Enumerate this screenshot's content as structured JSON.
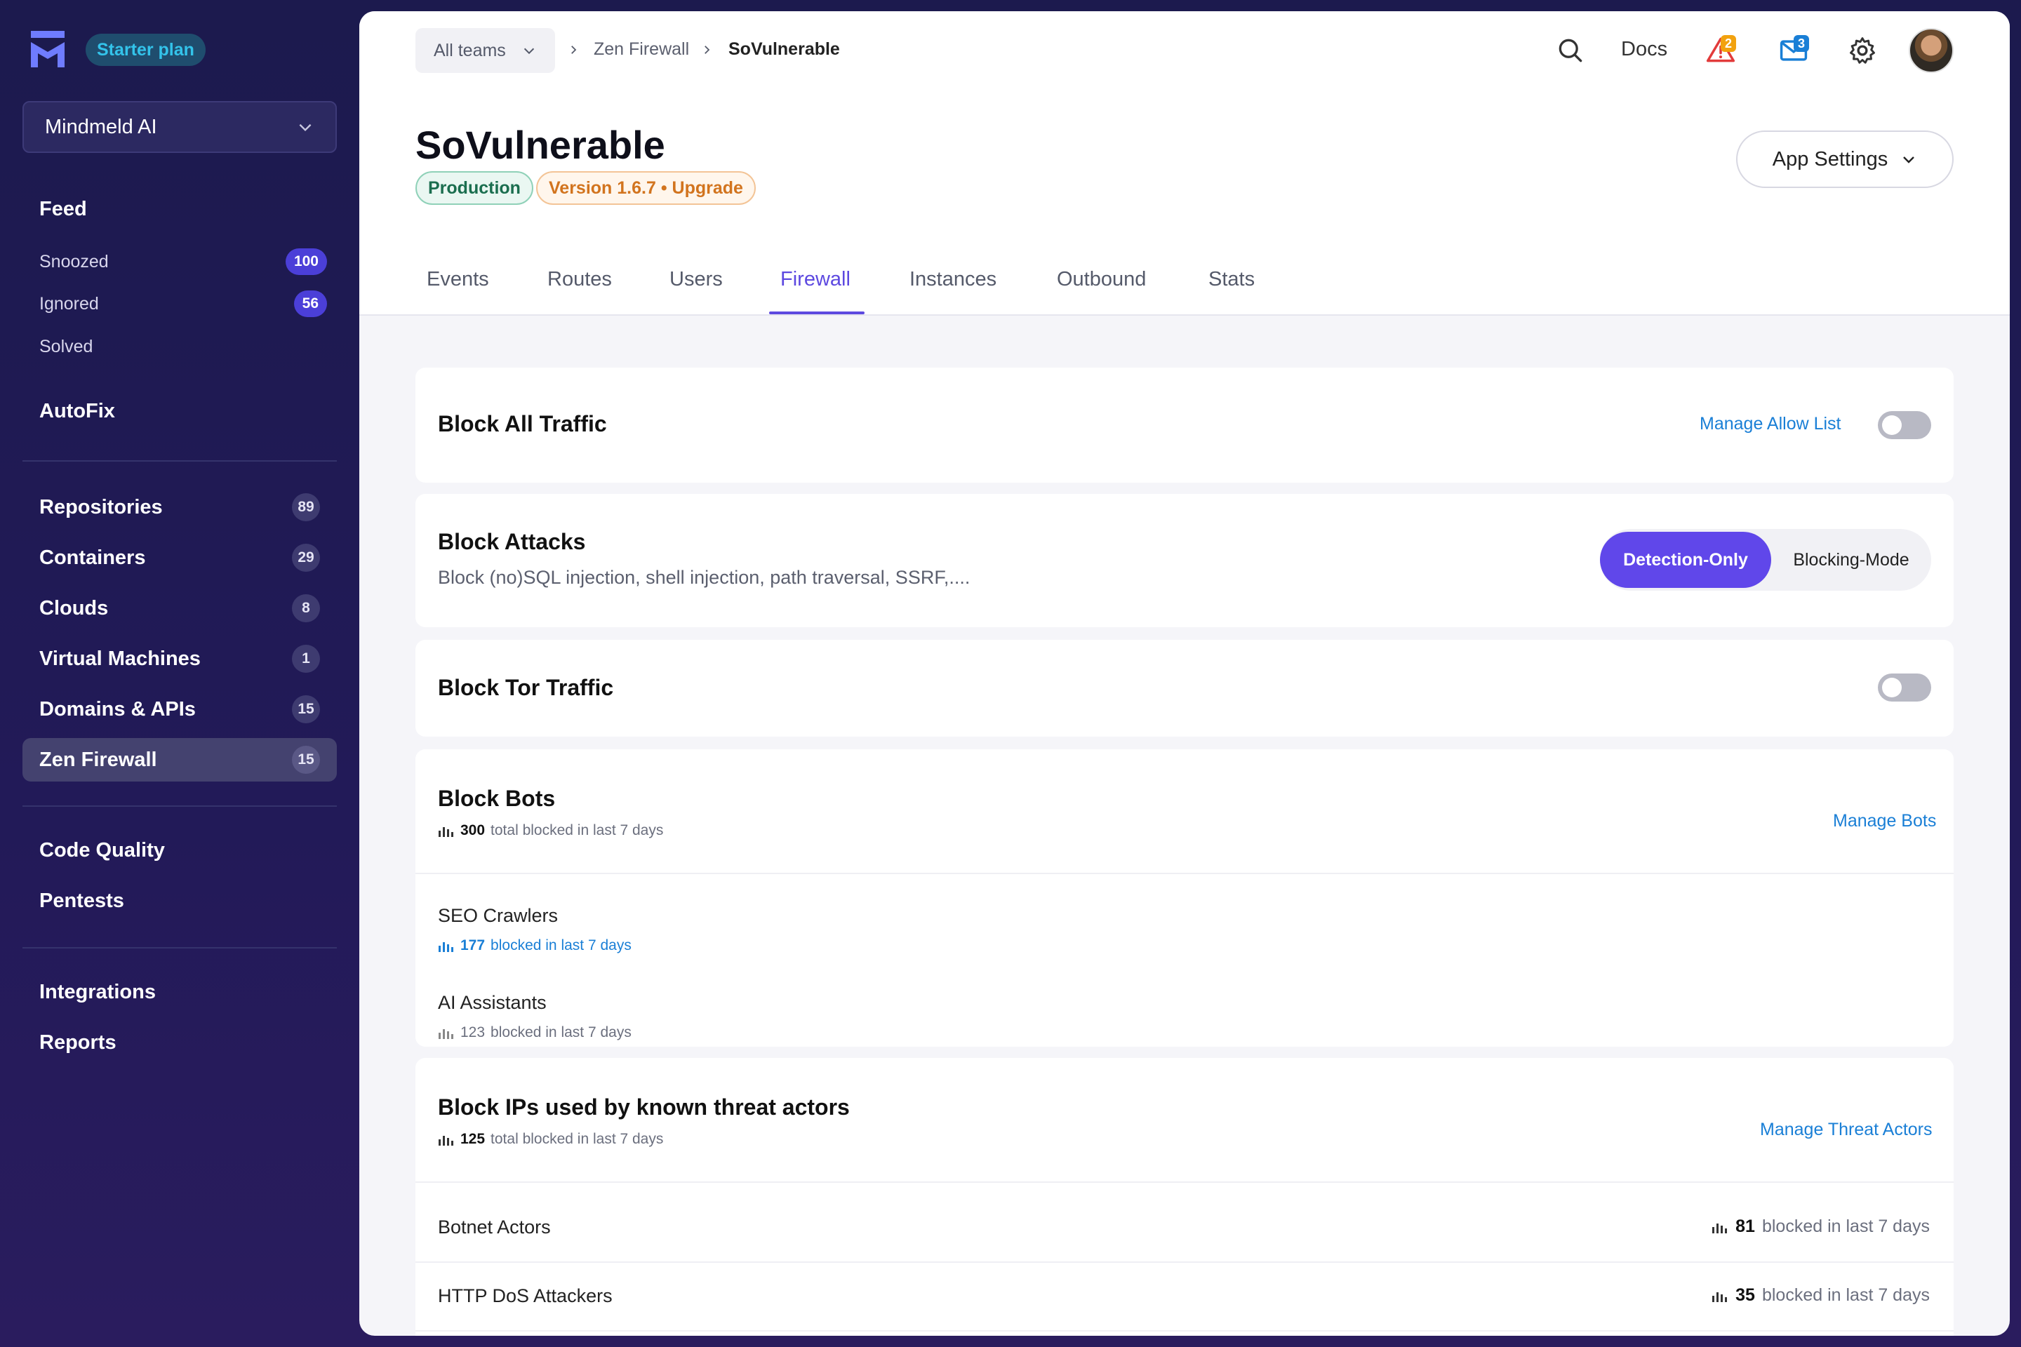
{
  "sidebar": {
    "plan": "Starter plan",
    "team": "Mindmeld AI",
    "feed": "Feed",
    "sub_items": [
      {
        "label": "Snoozed",
        "count": "100"
      },
      {
        "label": "Ignored",
        "count": "56"
      },
      {
        "label": "Solved",
        "count": ""
      }
    ],
    "autofix": "AutoFix",
    "resources": [
      {
        "label": "Repositories",
        "count": "89"
      },
      {
        "label": "Containers",
        "count": "29"
      },
      {
        "label": "Clouds",
        "count": "8"
      },
      {
        "label": "Virtual Machines",
        "count": "1"
      },
      {
        "label": "Domains & APIs",
        "count": "15"
      },
      {
        "label": "Zen Firewall",
        "count": "15"
      }
    ],
    "extras": [
      "Code Quality",
      "Pentests"
    ],
    "bottom": [
      "Integrations",
      "Reports"
    ]
  },
  "header": {
    "team_filter": "All teams",
    "breadcrumb": [
      "Zen Firewall",
      "SoVulnerable"
    ],
    "docs": "Docs",
    "alerts_count": "2",
    "inbox_count": "3",
    "title": "SoVulnerable",
    "env_badge": "Production",
    "version_badge": "Version 1.6.7 • Upgrade",
    "app_settings": "App Settings",
    "tabs": [
      "Events",
      "Routes",
      "Users",
      "Firewall",
      "Instances",
      "Outbound",
      "Stats"
    ],
    "active_tab": "Firewall"
  },
  "firewall": {
    "block_all": {
      "title": "Block All Traffic",
      "link": "Manage Allow List",
      "enabled": false
    },
    "block_attacks": {
      "title": "Block Attacks",
      "desc": "Block (no)SQL injection, shell injection, path traversal, SSRF,....",
      "mode_a": "Detection-Only",
      "mode_b": "Blocking-Mode",
      "active_mode": "Detection-Only"
    },
    "block_tor": {
      "title": "Block Tor Traffic",
      "enabled": false
    },
    "block_bots": {
      "title": "Block Bots",
      "total": "300",
      "total_suffix": "total blocked in last 7 days",
      "link": "Manage Bots",
      "rows": [
        {
          "name": "SEO Crawlers",
          "count": "177",
          "suffix": "blocked in last 7 days"
        },
        {
          "name": "AI Assistants",
          "count": "123",
          "suffix": "blocked in last 7 days"
        }
      ]
    },
    "block_threats": {
      "title": "Block IPs used by known threat actors",
      "total": "125",
      "total_suffix": "total blocked in last 7 days",
      "link": "Manage Threat Actors",
      "rows": [
        {
          "name": "Botnet Actors",
          "count": "81",
          "suffix": "blocked in last 7 days"
        },
        {
          "name": "HTTP DoS Attackers",
          "count": "35",
          "suffix": "blocked in last 7 days"
        }
      ]
    }
  },
  "colors": {
    "accent": "#6047ea",
    "link": "#1a7fd6",
    "sidebar_bg": "#1c1a4e"
  },
  "icons": [
    "aikido-logo-icon",
    "chevron-down-icon",
    "chevron-right-icon",
    "search-icon",
    "alert-triangle-icon",
    "mail-icon",
    "gear-icon",
    "bar-chart-icon"
  ]
}
